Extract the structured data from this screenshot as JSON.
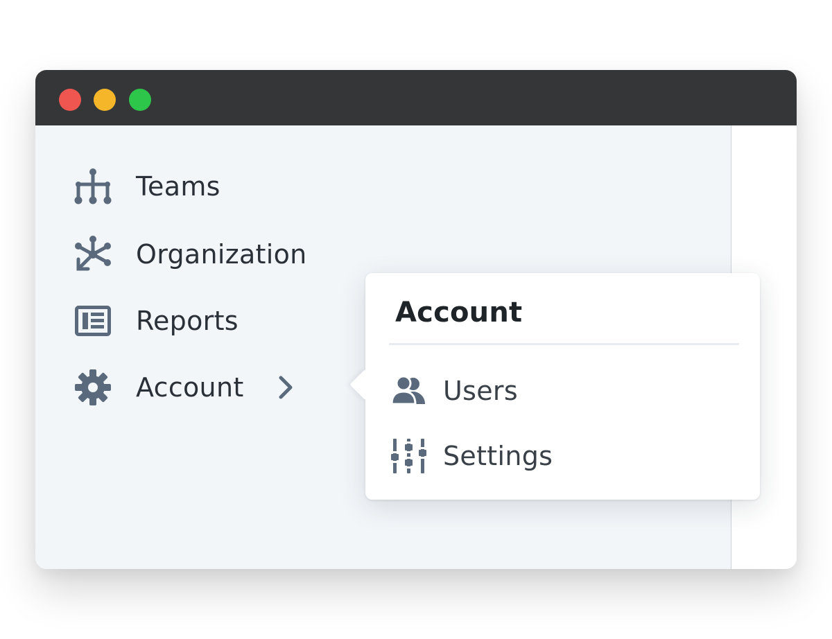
{
  "window": {
    "traffic_lights": [
      {
        "name": "close",
        "color": "#f05650"
      },
      {
        "name": "minimize",
        "color": "#f6b62a"
      },
      {
        "name": "maximize",
        "color": "#2ec64a"
      }
    ]
  },
  "sidebar": {
    "icon_color": "#5a6a7c",
    "items": [
      {
        "label": "Teams",
        "icon": "hierarchy-icon"
      },
      {
        "label": "Organization",
        "icon": "network-icon"
      },
      {
        "label": "Reports",
        "icon": "report-list-icon"
      },
      {
        "label": "Account",
        "icon": "gear-icon",
        "has_submenu": true,
        "submenu_icon": "chevron-right-icon"
      }
    ]
  },
  "popover": {
    "title": "Account",
    "items": [
      {
        "label": "Users",
        "icon": "users-icon"
      },
      {
        "label": "Settings",
        "icon": "sliders-icon"
      }
    ]
  }
}
